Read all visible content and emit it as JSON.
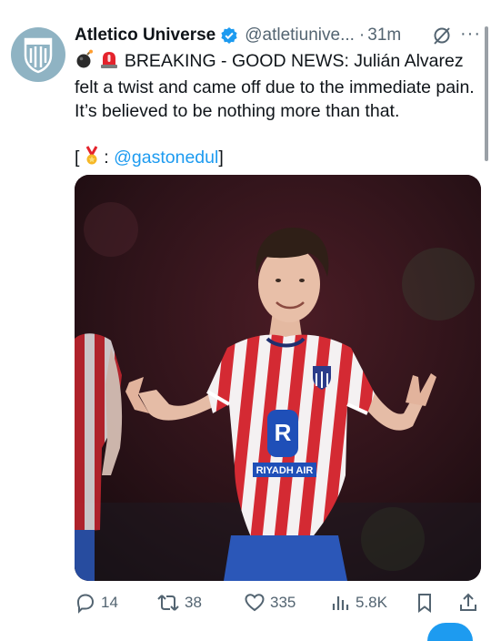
{
  "tweet": {
    "author_name": "Atletico Universe",
    "handle": "@atletiunive...",
    "separator": "·",
    "time": "31m",
    "more_label": "···",
    "text_main": "BREAKING - GOOD NEWS: Julián Alvarez felt a twist and came off due to the immediate pain. It’s believed to be nothing more than that.",
    "credit_open": "[",
    "credit_colon": ":",
    "credit_mention": "@gastonedul",
    "credit_close": "]",
    "emojis": [
      "bomb-emoji",
      "siren-emoji",
      "medal-emoji"
    ]
  },
  "photo": {
    "sponsor": "RIYADH AIR",
    "description_icon": "player-celebrating-photo"
  },
  "actions": {
    "replies": "14",
    "reposts": "38",
    "likes": "335",
    "views": "5.8K"
  },
  "colors": {
    "link": "#1d9bf0",
    "muted": "#536471",
    "verified": "#1d9bf0",
    "avatar_bg": "#8fb3c3",
    "jersey_red": "#d42a33"
  }
}
